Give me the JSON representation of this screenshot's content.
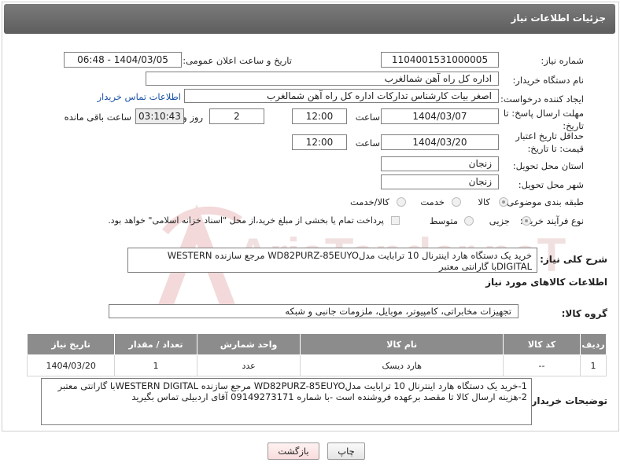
{
  "header": {
    "title": "جزئیات اطلاعات نیاز"
  },
  "labels": {
    "need_number": "شماره نیاز:",
    "announce_datetime": "تاریخ و ساعت اعلان عمومی:",
    "buyer_org": "نام دستگاه خریدار:",
    "requester": "ایجاد کننده درخواست:",
    "contact_link": "اطلاعات تماس خریدار",
    "reply_deadline": "مهلت ارسال پاسخ: تا تاریخ:",
    "time_label": "ساعت",
    "day_label": "روز و",
    "remaining_label": "ساعت باقی مانده",
    "price_validity": "حداقل تاریخ اعتبار قیمت: تا تاریخ:",
    "delivery_province": "استان محل تحویل:",
    "delivery_city": "شهر محل تحویل:",
    "category": "طبقه بندی موضوعی:",
    "purchase_type": "نوع فرآیند خرید :",
    "general_desc": "شرح کلی نیاز:",
    "goods_info": "اطلاعات کالاهای مورد نیاز",
    "goods_group": "گروه کالا:",
    "buyer_notes": "توضیحات خریدار:"
  },
  "values": {
    "need_number": "1104001531000005",
    "announce_datetime": "1404/03/05 - 06:48",
    "buyer_org": "اداره کل راه آهن شمالغرب",
    "requester": "اصغر بیات کارشناس تدارکات اداره کل راه آهن شمالغرب",
    "reply_date": "1404/03/07",
    "reply_time": "12:00",
    "remaining_days": "2",
    "remaining_time": "03:10:43",
    "price_date": "1404/03/20",
    "price_time": "12:00",
    "province": "زنجان",
    "city": "زنجان",
    "general_desc": "خرید یک دستگاه هارد اینترنال 10 ترابایت مدلWD82PURZ-85EUYO مرجع سازنده  WESTERN DIGITALبا گارانتی معتبر",
    "goods_group": "تجهیزات مخابراتی، کامپیوتر، موبایل، ملزومات جانبی و شبکه",
    "buyer_notes_line1": "1-خرید یک دستگاه هارد اینترنال 10 ترابایت مدلWD82PURZ-85EUYO مرجع سازنده  WESTERN DIGITALبا گارانتی معتبر",
    "buyer_notes_line2": "2-هزینه ارسال کالا تا مقصد برعهده فروشنده است -با شماره 09149273171  آقای اردبیلی تماس بگیرید"
  },
  "category_options": [
    {
      "label": "کالا",
      "selected": true
    },
    {
      "label": "خدمت",
      "selected": false
    },
    {
      "label": "کالا/خدمت",
      "selected": false
    }
  ],
  "purchase_options": [
    {
      "label": "جزیی",
      "selected": true
    },
    {
      "label": "متوسط",
      "selected": false
    }
  ],
  "payment_note": "پرداخت تمام یا بخشی از مبلغ خرید،از محل \"اسناد خزانه اسلامی\" خواهد بود.",
  "table": {
    "headers": [
      "ردیف",
      "کد کالا",
      "نام کالا",
      "واحد شمارش",
      "تعداد / مقدار",
      "تاریخ نیاز"
    ],
    "rows": [
      [
        "1",
        "--",
        "هارد دیسک",
        "عدد",
        "1",
        "1404/03/20"
      ]
    ]
  },
  "buttons": {
    "print": "چاپ",
    "back": "بازگشت"
  },
  "watermark": {
    "text": "AriaTender.neT"
  }
}
